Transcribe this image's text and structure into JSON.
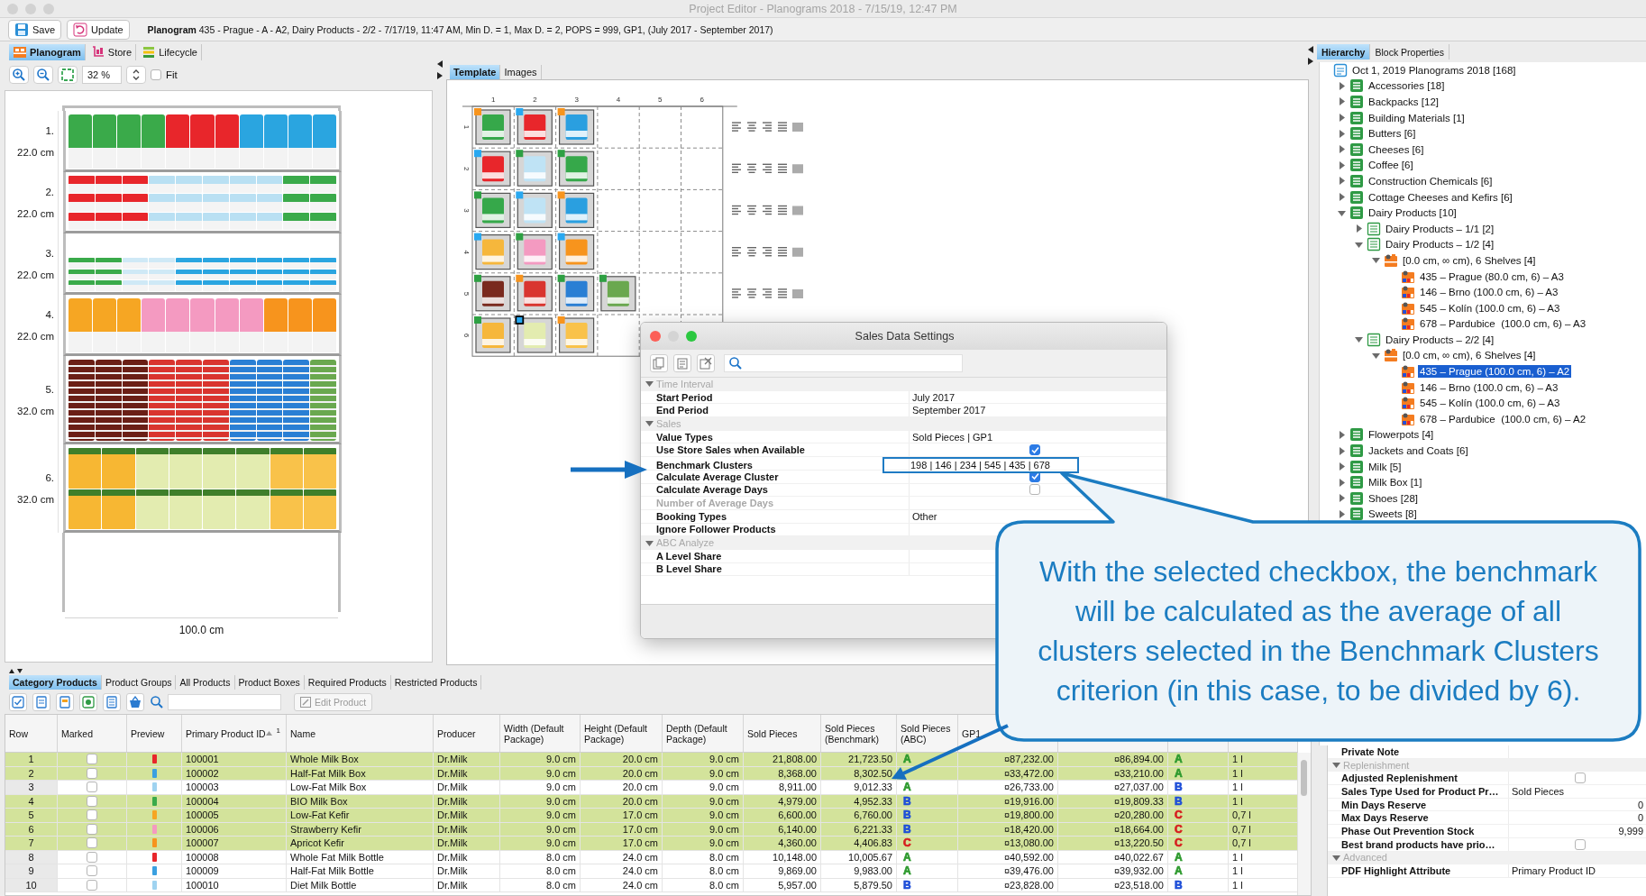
{
  "window": {
    "title": "Project Editor - Planograms 2018 - 7/15/19, 12:47 PM",
    "controls": [
      {
        "color": "#d2d2d2"
      },
      {
        "color": "#d2d2d2"
      },
      {
        "color": "#d2d2d2"
      }
    ]
  },
  "toolbar": {
    "buttons": [
      {
        "label": "Save",
        "kind": "save"
      },
      {
        "label": "Update",
        "kind": "update"
      }
    ],
    "info": "**Planogram** 435 - Prague - A - A2, Dairy Products - 2/2 - 7/17/19, 11:47 AM, Min D. = 1, Max D. = 2, POPS = 999, GP1, (July 2017 - September 2017)"
  },
  "view_tabs": [
    {
      "label": "Planogram",
      "kind": "planogram",
      "selected": true
    },
    {
      "label": "Store",
      "kind": "store",
      "selected": false
    },
    {
      "label": "Lifecycle",
      "kind": "lifecycle",
      "selected": false
    }
  ],
  "zoom": {
    "value": "32 %",
    "fit_label": "Fit",
    "fit_checked": false
  },
  "planogram": {
    "width_label": "100.0 cm",
    "shelves": [
      {
        "number": "1.",
        "height": "22.0 cm",
        "kind": "cartons",
        "facings": [
          {
            "color": "#3aaa4a"
          },
          {
            "color": "#3aaa4a"
          },
          {
            "color": "#3aaa4a"
          },
          {
            "color": "#3aaa4a"
          },
          {
            "color": "#e8262b"
          },
          {
            "color": "#e8262b"
          },
          {
            "color": "#e8262b"
          },
          {
            "color": "#2aa5e0"
          },
          {
            "color": "#2aa5e0"
          },
          {
            "color": "#2aa5e0"
          },
          {
            "color": "#2aa5e0"
          }
        ]
      },
      {
        "number": "2.",
        "height": "22.0 cm",
        "kind": "boxes",
        "facings": [
          {
            "color": "#e8262b"
          },
          {
            "color": "#e8262b"
          },
          {
            "color": "#e8262b"
          },
          {
            "color": "#b9e0f3"
          },
          {
            "color": "#b9e0f3"
          },
          {
            "color": "#b9e0f3"
          },
          {
            "color": "#b9e0f3"
          },
          {
            "color": "#b9e0f3"
          },
          {
            "color": "#3aaa4a"
          },
          {
            "color": "#3aaa4a"
          }
        ]
      },
      {
        "number": "3.",
        "height": "22.0 cm",
        "kind": "small_boxes",
        "facings": [
          {
            "color": "#3aaa4a"
          },
          {
            "color": "#3aaa4a"
          },
          {
            "color": "#cfe9f6"
          },
          {
            "color": "#cfe9f6"
          },
          {
            "color": "#2aa5e0"
          },
          {
            "color": "#2aa5e0"
          },
          {
            "color": "#2aa5e0"
          },
          {
            "color": "#2aa5e0"
          },
          {
            "color": "#2aa5e0"
          },
          {
            "color": "#2aa5e0"
          }
        ]
      },
      {
        "number": "4.",
        "height": "22.0 cm",
        "kind": "cartons",
        "facings": [
          {
            "color": "#f6a623"
          },
          {
            "color": "#f6a623"
          },
          {
            "color": "#f6a623"
          },
          {
            "color": "#f49ac1"
          },
          {
            "color": "#f49ac1"
          },
          {
            "color": "#f49ac1"
          },
          {
            "color": "#f49ac1"
          },
          {
            "color": "#f49ac1"
          },
          {
            "color": "#f7941d"
          },
          {
            "color": "#f7941d"
          },
          {
            "color": "#f7941d"
          }
        ]
      },
      {
        "number": "5.",
        "height": "32.0 cm",
        "kind": "cups",
        "facings": [
          {
            "color": "#6b1f16"
          },
          {
            "color": "#6b1f16"
          },
          {
            "color": "#6b1f16"
          },
          {
            "color": "#d9352f"
          },
          {
            "color": "#d9352f"
          },
          {
            "color": "#d9352f"
          },
          {
            "color": "#2a7fd4"
          },
          {
            "color": "#2a7fd4"
          },
          {
            "color": "#2a7fd4"
          },
          {
            "color": "#6aa84f"
          }
        ]
      },
      {
        "number": "6.",
        "height": "32.0 cm",
        "kind": "cheese",
        "facings": [
          {
            "color": "#f7b733"
          },
          {
            "color": "#f7b733"
          },
          {
            "color": "#e3ecb0"
          },
          {
            "color": "#e3ecb0"
          },
          {
            "color": "#e3ecb0"
          },
          {
            "color": "#e3ecb0"
          },
          {
            "color": "#f9c24a"
          },
          {
            "color": "#f9c24a"
          }
        ]
      }
    ]
  },
  "editor_tabs": [
    {
      "label": "Template",
      "selected": true
    },
    {
      "label": "Images",
      "selected": false
    }
  ],
  "template": {
    "columns": [
      "1",
      "2",
      "3",
      "4",
      "5",
      "6"
    ],
    "rows": [
      {
        "label": "1",
        "align_tools": true,
        "cells": [
          {
            "color": "#f7941d",
            "selected": false,
            "product": {
              "color": "#36a84a"
            }
          },
          {
            "color": "#29a8f0",
            "selected": false,
            "product": {
              "color": "#e8262b"
            }
          },
          {
            "color": "#f7941d",
            "selected": false,
            "product": {
              "color": "#2a9fe0"
            }
          }
        ]
      },
      {
        "label": "2",
        "align_tools": true,
        "cells": [
          {
            "color": "#29a8f0",
            "selected": false,
            "product": {
              "color": "#e8262b"
            }
          },
          {
            "color": "#2ea043",
            "selected": false,
            "product": {
              "color": "#bfe3f5"
            }
          },
          {
            "color": "#2ea043",
            "selected": false,
            "product": {
              "color": "#36a84a"
            }
          }
        ]
      },
      {
        "label": "3",
        "align_tools": true,
        "cells": [
          {
            "color": "#2ea043",
            "selected": false,
            "product": {
              "color": "#36a84a"
            }
          },
          {
            "color": "#29a8f0",
            "selected": false,
            "product": {
              "color": "#bfe3f5"
            }
          },
          {
            "color": "#f7941d",
            "selected": false,
            "product": {
              "color": "#2a9fe0"
            }
          }
        ]
      },
      {
        "label": "4",
        "align_tools": true,
        "cells": [
          {
            "color": "#29a8f0",
            "selected": false,
            "product": {
              "color": "#f6b73c"
            }
          },
          {
            "color": "#2ea043",
            "selected": false,
            "product": {
              "color": "#f49ac1"
            }
          },
          {
            "color": "#29a8f0",
            "selected": false,
            "product": {
              "color": "#f7941d"
            }
          }
        ]
      },
      {
        "label": "5",
        "align_tools": true,
        "cells": [
          {
            "color": "#2ea043",
            "selected": false,
            "product": {
              "color": "#7a2a1e"
            }
          },
          {
            "color": "#f7941d",
            "selected": false,
            "product": {
              "color": "#d9352f"
            }
          },
          {
            "color": "#2ea043",
            "selected": false,
            "product": {
              "color": "#2a7fd4"
            }
          },
          {
            "color": "#2ea043",
            "selected": false,
            "product": {
              "color": "#6aa84f"
            }
          }
        ]
      },
      {
        "label": "6",
        "cells": [
          {
            "color": "#2ea043",
            "selected": false,
            "product": {
              "color": "#f6b73c"
            }
          },
          {
            "color": "#29a8f0",
            "selected": true,
            "product": {
              "color": "#e3ecb0"
            }
          },
          {
            "color": "#f7941d",
            "selected": false,
            "product": {
              "color": "#f9c24a"
            }
          }
        ]
      }
    ]
  },
  "dialog": {
    "title": "Sales Data Settings",
    "controls": [
      {
        "color": "#fc5f57"
      },
      {
        "color": "#d4d4d4"
      },
      {
        "color": "#2bc840"
      }
    ],
    "rows": [
      {
        "kind": "group",
        "label": "Time Interval",
        "expanded": true
      },
      {
        "kind": "text",
        "label": "Start Period",
        "value": "July 2017",
        "disabled": false
      },
      {
        "kind": "text",
        "label": "End Period",
        "value": "September 2017",
        "disabled": false
      },
      {
        "kind": "group",
        "label": "Sales",
        "expanded": true
      },
      {
        "kind": "text",
        "label": "Value Types",
        "value": "Sold Pieces | GP1",
        "disabled": false
      },
      {
        "kind": "checkbox",
        "label": "Use Store Sales when Available",
        "checked": true,
        "disabled": false
      },
      {
        "kind": "text",
        "label": "Benchmark Clusters",
        "value": "198 | 146 | 234 | 545 | 435 | 678",
        "disabled": false,
        "highlighted": true
      },
      {
        "kind": "checkbox",
        "label": "Calculate Average Cluster",
        "checked": true,
        "disabled": false
      },
      {
        "kind": "checkbox",
        "label": "Calculate Average Days",
        "checked": false,
        "disabled": false
      },
      {
        "kind": "text",
        "label": "Number of Average Days",
        "disabled": true
      },
      {
        "kind": "text",
        "label": "Booking Types",
        "value": "Other",
        "disabled": false
      },
      {
        "kind": "text",
        "label": "Ignore Follower Products",
        "disabled": false
      },
      {
        "kind": "group",
        "label": "ABC Analyze",
        "expanded": true
      },
      {
        "kind": "text",
        "label": "A Level Share",
        "disabled": false
      },
      {
        "kind": "text",
        "label": "B Level Share",
        "disabled": false
      }
    ]
  },
  "callout": {
    "text": "With the selected checkbox, the benchmark will be calculated as the average of all clusters selected in the Benchmark Clusters criterion (in this case, to be divided by 6)."
  },
  "bottom_tabs": [
    {
      "label": "Category Products",
      "selected": true
    },
    {
      "label": "Product Groups",
      "selected": false
    },
    {
      "label": "All Products",
      "selected": false
    },
    {
      "label": "Product Boxes",
      "selected": false
    },
    {
      "label": "Required Products",
      "selected": false
    },
    {
      "label": "Restricted Products",
      "selected": false
    }
  ],
  "product_toolbar": {
    "edit_button": {
      "label": "Edit Product",
      "disabled": true
    }
  },
  "table": {
    "columns": [
      {
        "label": "Row"
      },
      {
        "label": "Marked"
      },
      {
        "label": "Preview"
      },
      {
        "label": "Primary Product ID",
        "sort_index": "1"
      },
      {
        "label": "Name"
      },
      {
        "label": "Producer"
      },
      {
        "label": "Width (Default Package)"
      },
      {
        "label": "Height (Default Package)"
      },
      {
        "label": "Depth (Default Package)"
      },
      {
        "label": "Sold Pieces"
      },
      {
        "label": "Sold Pieces (Benchmark)"
      },
      {
        "label": "Sold Pieces (ABC)"
      },
      {
        "label": "GP1"
      }
    ],
    "rows": [
      {
        "selected": true,
        "marked": false,
        "color": "#e8262b",
        "row": "1",
        "id": "100001",
        "name": "Whole Milk Box",
        "producer": "Dr.Milk",
        "width": "9.0 cm",
        "height": "20.0 cm",
        "depth": "9.0 cm",
        "sold": "21,808.00",
        "benchmark": "21,723.50",
        "abc": {
          "text": "A",
          "color": "#2e9a2e"
        },
        "gp1": "¤87,232.00",
        "column_14": "¤86,894.00",
        "column_15": {
          "text": "A",
          "color": "#2e9a2e"
        },
        "column_16": "1 l"
      },
      {
        "selected": true,
        "marked": false,
        "color": "#3aa0e0",
        "row": "2",
        "id": "100002",
        "name": "Half-Fat Milk Box",
        "producer": "Dr.Milk",
        "width": "9.0 cm",
        "height": "20.0 cm",
        "depth": "9.0 cm",
        "sold": "8,368.00",
        "benchmark": "8,302.50",
        "gp1": "¤33,472.00",
        "column_14": "¤33,210.00",
        "column_15": {
          "text": "A",
          "color": "#2e9a2e"
        },
        "column_16": "1 l"
      },
      {
        "selected": false,
        "marked": false,
        "color": "#9fd3f0",
        "row": "3",
        "id": "100003",
        "name": "Low-Fat Milk Box",
        "producer": "Dr.Milk",
        "width": "9.0 cm",
        "height": "20.0 cm",
        "depth": "9.0 cm",
        "sold": "8,911.00",
        "benchmark": "9,012.33",
        "abc": {
          "text": "A",
          "color": "#2e9a2e"
        },
        "gp1": "¤26,733.00",
        "column_14": "¤27,037.00",
        "column_15": {
          "text": "B",
          "color": "#1f4fd8"
        },
        "column_16": "1 l"
      },
      {
        "selected": true,
        "marked": false,
        "color": "#3aaa4a",
        "row": "4",
        "id": "100004",
        "name": "BIO Milk Box",
        "producer": "Dr.Milk",
        "width": "9.0 cm",
        "height": "20.0 cm",
        "depth": "9.0 cm",
        "sold": "4,979.00",
        "benchmark": "4,952.33",
        "abc": {
          "text": "B",
          "color": "#1f4fd8"
        },
        "gp1": "¤19,916.00",
        "column_14": "¤19,809.33",
        "column_15": {
          "text": "B",
          "color": "#1f4fd8"
        },
        "column_16": "1 l"
      },
      {
        "selected": true,
        "marked": false,
        "color": "#f6a623",
        "row": "5",
        "id": "100005",
        "name": "Low-Fat Kefir",
        "producer": "Dr.Milk",
        "width": "9.0 cm",
        "height": "17.0 cm",
        "depth": "9.0 cm",
        "sold": "6,600.00",
        "benchmark": "6,760.00",
        "abc": {
          "text": "B",
          "color": "#1f4fd8"
        },
        "gp1": "¤19,800.00",
        "column_14": "¤20,280.00",
        "column_15": {
          "text": "C",
          "color": "#d62020"
        },
        "column_16": "0,7 l"
      },
      {
        "selected": true,
        "marked": false,
        "color": "#f49ac1",
        "row": "6",
        "id": "100006",
        "name": "Strawberry Kefir",
        "producer": "Dr.Milk",
        "width": "9.0 cm",
        "height": "17.0 cm",
        "depth": "9.0 cm",
        "sold": "6,140.00",
        "benchmark": "6,221.33",
        "abc": {
          "text": "B",
          "color": "#1f4fd8"
        },
        "gp1": "¤18,420.00",
        "column_14": "¤18,664.00",
        "column_15": {
          "text": "C",
          "color": "#d62020"
        },
        "column_16": "0,7 l"
      },
      {
        "selected": true,
        "marked": false,
        "color": "#f7941d",
        "row": "7",
        "id": "100007",
        "name": "Apricot Kefir",
        "producer": "Dr.Milk",
        "width": "9.0 cm",
        "height": "17.0 cm",
        "depth": "9.0 cm",
        "sold": "4,360.00",
        "benchmark": "4,406.83",
        "abc": {
          "text": "C",
          "color": "#d62020"
        },
        "gp1": "¤13,080.00",
        "column_14": "¤13,220.50",
        "column_15": {
          "text": "C",
          "color": "#d62020"
        },
        "column_16": "0,7 l"
      },
      {
        "selected": false,
        "marked": false,
        "color": "#e8262b",
        "row": "8",
        "id": "100008",
        "name": "Whole Fat Milk Bottle",
        "producer": "Dr.Milk",
        "width": "8.0 cm",
        "height": "24.0 cm",
        "depth": "8.0 cm",
        "sold": "10,148.00",
        "benchmark": "10,005.67",
        "abc": {
          "text": "A",
          "color": "#2e9a2e"
        },
        "gp1": "¤40,592.00",
        "column_14": "¤40,022.67",
        "column_15": {
          "text": "A",
          "color": "#2e9a2e"
        },
        "column_16": "1 l"
      },
      {
        "selected": false,
        "marked": false,
        "color": "#3aa0e0",
        "row": "9",
        "id": "100009",
        "name": "Half-Fat Milk Bottle",
        "producer": "Dr.Milk",
        "width": "8.0 cm",
        "height": "24.0 cm",
        "depth": "8.0 cm",
        "sold": "9,869.00",
        "benchmark": "9,983.00",
        "abc": {
          "text": "A",
          "color": "#2e9a2e"
        },
        "gp1": "¤39,476.00",
        "column_14": "¤39,932.00",
        "column_15": {
          "text": "A",
          "color": "#2e9a2e"
        },
        "column_16": "1 l"
      },
      {
        "selected": false,
        "marked": false,
        "color": "#9fd3f0",
        "row": "10",
        "id": "100010",
        "name": "Diet Milk Bottle",
        "producer": "Dr.Milk",
        "width": "8.0 cm",
        "height": "24.0 cm",
        "depth": "8.0 cm",
        "sold": "5,957.00",
        "benchmark": "5,879.50",
        "abc": {
          "text": "B",
          "color": "#1f4fd8"
        },
        "gp1": "¤23,828.00",
        "column_14": "¤23,518.00",
        "column_15": {
          "text": "B",
          "color": "#1f4fd8"
        },
        "column_16": "1 l"
      }
    ]
  },
  "hierarchy_tabs": [
    {
      "label": "Hierarchy",
      "selected": true
    },
    {
      "label": "Block Properties",
      "selected": false
    }
  ],
  "tree": {
    "label": "Oct 1, 2019 Planograms 2018 [168]",
    "kind": "root",
    "selected": false,
    "children": [
      {
        "label": "Accessories [18]",
        "kind": "category",
        "expanded": false,
        "selected": false
      },
      {
        "label": "Backpacks [12]",
        "kind": "category",
        "expanded": false,
        "selected": false
      },
      {
        "label": "Building Materials [1]",
        "kind": "category",
        "expanded": false,
        "selected": false
      },
      {
        "label": "Butters [6]",
        "kind": "category",
        "expanded": false,
        "selected": false
      },
      {
        "label": "Cheeses [6]",
        "kind": "category",
        "expanded": false,
        "selected": false
      },
      {
        "label": "Coffee [6]",
        "kind": "category",
        "expanded": false,
        "selected": false
      },
      {
        "label": "Construction Chemicals [6]",
        "kind": "category",
        "expanded": false,
        "selected": false
      },
      {
        "label": "Cottage Cheeses and Kefirs [6]",
        "kind": "category",
        "expanded": false,
        "selected": false
      },
      {
        "label": "Dairy Products [10]",
        "kind": "category",
        "expanded": true,
        "selected": false,
        "children": [
          {
            "label": "Dairy Products – 1/1 [2]",
            "kind": "subcategory",
            "expanded": false,
            "selected": false
          },
          {
            "label": "Dairy Products – 1/2 [4]",
            "kind": "subcategory",
            "expanded": true,
            "selected": false,
            "children": [
              {
                "label": "[0.0 cm, ∞ cm), 6 Shelves [4]",
                "kind": "cluster",
                "expanded": true,
                "selected": false,
                "children": [
                  {
                    "label": "435 – Prague (80.0 cm, 6) – A3",
                    "kind": "planogram",
                    "selected": false
                  },
                  {
                    "label": "146 – Brno (100.0 cm, 6) – A3",
                    "kind": "planogram",
                    "selected": false
                  },
                  {
                    "label": "545 – Kolín (100.0 cm, 6) – A3",
                    "kind": "planogram",
                    "selected": false
                  },
                  {
                    "label": "678 – Pardubice  (100.0 cm, 6) – A3",
                    "kind": "planogram",
                    "selected": false
                  }
                ]
              }
            ]
          },
          {
            "label": "Dairy Products – 2/2 [4]",
            "kind": "subcategory",
            "expanded": true,
            "selected": false,
            "children": [
              {
                "label": "[0.0 cm, ∞ cm), 6 Shelves [4]",
                "kind": "cluster",
                "expanded": true,
                "selected": false,
                "children": [
                  {
                    "label": "435 – Prague (100.0 cm, 6) – A2",
                    "kind": "planogram",
                    "selected": true
                  },
                  {
                    "label": "146 – Brno (100.0 cm, 6) – A3",
                    "kind": "planogram",
                    "selected": false
                  },
                  {
                    "label": "545 – Kolín (100.0 cm, 6) – A3",
                    "kind": "planogram",
                    "selected": false
                  },
                  {
                    "label": "678 – Pardubice  (100.0 cm, 6) – A2",
                    "kind": "planogram",
                    "selected": false
                  }
                ]
              }
            ]
          }
        ]
      },
      {
        "label": "Flowerpots [4]",
        "kind": "category",
        "expanded": false,
        "selected": false
      },
      {
        "label": "Jackets and Coats [6]",
        "kind": "category",
        "expanded": false,
        "selected": false
      },
      {
        "label": "Milk [5]",
        "kind": "category",
        "expanded": false,
        "selected": false
      },
      {
        "label": "Milk Box [1]",
        "kind": "category",
        "expanded": false,
        "selected": false
      },
      {
        "label": "Shoes [28]",
        "kind": "category",
        "expanded": false,
        "selected": false
      },
      {
        "label": "Sweets [8]",
        "kind": "category",
        "expanded": false,
        "selected": false
      }
    ]
  },
  "properties": [
    {
      "kind": "text",
      "label": "Private Note"
    },
    {
      "kind": "group",
      "label": "Replenishment",
      "expanded": true
    },
    {
      "kind": "checkbox",
      "label": "Adjusted Replenishment",
      "checked": false
    },
    {
      "kind": "text",
      "label": "Sales Type Used for Product Pr…",
      "value": "Sold Pieces"
    },
    {
      "kind": "number",
      "label": "Min Days Reserve",
      "value": "0"
    },
    {
      "kind": "number",
      "label": "Max Days Reserve",
      "value": "0"
    },
    {
      "kind": "number",
      "label": "Phase Out Prevention Stock",
      "value": "9,999"
    },
    {
      "kind": "checkbox",
      "label": "Best brand products have prio…",
      "checked": false
    },
    {
      "kind": "group",
      "label": "Advanced",
      "expanded": true
    },
    {
      "kind": "text",
      "label": "PDF Highlight Attribute",
      "value": "Primary Product ID"
    }
  ]
}
